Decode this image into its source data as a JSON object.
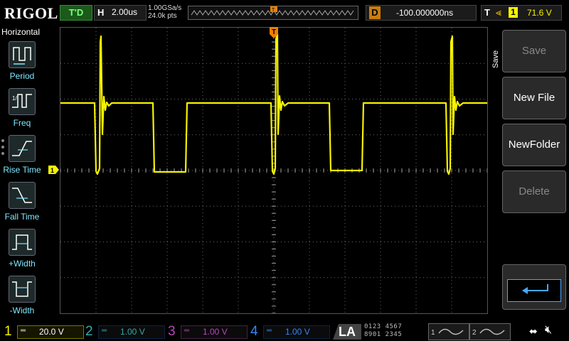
{
  "brand": "RIGOL",
  "run_state": "T'D",
  "horizontal": {
    "key": "H",
    "timebase": "2.00us",
    "sample_rate": "1.00GSa/s",
    "points": "24.0k pts"
  },
  "delay": {
    "key": "D",
    "value": "-100.000000ns"
  },
  "trigger": {
    "key": "T",
    "edge_icon": "rising-edge-icon",
    "source": "1",
    "level": "71.6 V"
  },
  "trigger_marker": "T",
  "left_menu": {
    "title": "Horizontal",
    "items": [
      {
        "label": "Period",
        "icon": "period-icon"
      },
      {
        "label": "Freq",
        "icon": "freq-icon"
      },
      {
        "label": "Rise Time",
        "icon": "rise-time-icon"
      },
      {
        "label": "Fall Time",
        "icon": "fall-time-icon"
      },
      {
        "label": "+Width",
        "icon": "plus-width-icon"
      },
      {
        "label": "-Width",
        "icon": "minus-width-icon"
      }
    ]
  },
  "right_menu": {
    "title": "Save",
    "buttons": [
      {
        "label": "Save",
        "enabled": false
      },
      {
        "label": "New File",
        "enabled": true
      },
      {
        "label": "NewFolder",
        "enabled": true
      },
      {
        "label": "Delete",
        "enabled": false
      }
    ],
    "back_icon": "return-arrow-icon"
  },
  "ch1_marker": "1",
  "channels": [
    {
      "num": "1",
      "coupling": "DC",
      "scale": "20.0 V",
      "color": "#f7f300"
    },
    {
      "num": "2",
      "coupling": "DC",
      "scale": "1.00 V",
      "color": "#33aaaa"
    },
    {
      "num": "3",
      "coupling": "DC",
      "scale": "1.00 V",
      "color": "#bb44bb"
    },
    {
      "num": "4",
      "coupling": "DC",
      "scale": "1.00 V",
      "color": "#3388ff"
    }
  ],
  "la": {
    "label": "LA",
    "bits_row1": "0123 4567",
    "bits_row2": "8901 2345"
  },
  "generators": [
    {
      "num": "1"
    },
    {
      "num": "2"
    }
  ],
  "status_icons": {
    "usb": "usb-icon",
    "sound": "muted-speaker-icon"
  },
  "colors": {
    "trace": "#f7f300",
    "grid": "#6a6a6a",
    "trigger": "#f08000",
    "menu_label": "#7fe7ff"
  }
}
